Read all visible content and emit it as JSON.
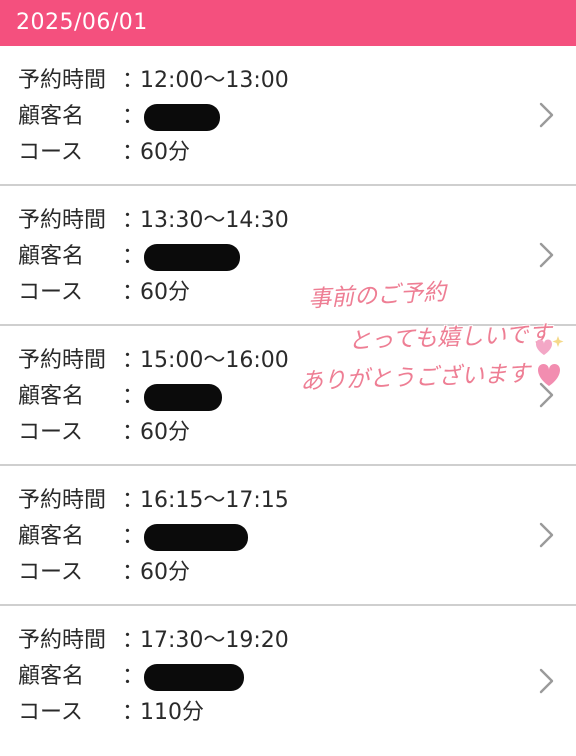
{
  "header": {
    "date": "2025/06/01"
  },
  "labels": {
    "time": "予約時間",
    "customer": "顧客名",
    "course": "コース",
    "colon": "："
  },
  "reservations": [
    {
      "time": "12:00～13:00",
      "course": "60分"
    },
    {
      "time": "13:30～14:30",
      "course": "60分"
    },
    {
      "time": "15:00～16:00",
      "course": "60分"
    },
    {
      "time": "16:15～17:15",
      "course": "60分"
    },
    {
      "time": "17:30～19:20",
      "course": "110分"
    }
  ],
  "overlay": {
    "line1": "事前のご予約",
    "line2": "とっても嬉しいです",
    "line3": "ありがとうございます",
    "color": "#ee7e94"
  },
  "colors": {
    "accent": "#f4507e",
    "divider": "#cfcfcf",
    "chevron": "#9a9a9a"
  },
  "icons": {
    "row_action": "chevron-right-icon",
    "decoration": "heart-icon"
  }
}
